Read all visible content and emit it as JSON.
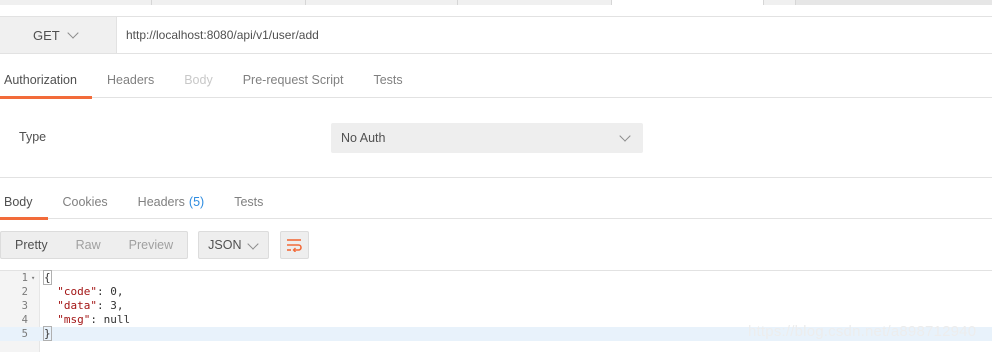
{
  "request": {
    "method": "GET",
    "url": "http://localhost:8080/api/v1/user/add"
  },
  "request_tabs": [
    {
      "label": "Authorization",
      "state": "active"
    },
    {
      "label": "Headers",
      "state": "normal"
    },
    {
      "label": "Body",
      "state": "disabled"
    },
    {
      "label": "Pre-request Script",
      "state": "normal"
    },
    {
      "label": "Tests",
      "state": "normal"
    }
  ],
  "auth": {
    "type_label": "Type",
    "type_value": "No Auth"
  },
  "response_tabs": {
    "body": "Body",
    "cookies": "Cookies",
    "headers": "Headers",
    "headers_count": "(5)",
    "tests": "Tests"
  },
  "view_modes": [
    "Pretty",
    "Raw",
    "Preview"
  ],
  "active_view_mode": "Pretty",
  "format": "JSON",
  "code_lines": [
    {
      "num": "1",
      "text": "{"
    },
    {
      "num": "2",
      "key": "\"code\"",
      "sep": ": ",
      "value": "0",
      "end": ","
    },
    {
      "num": "3",
      "key": "\"data\"",
      "sep": ": ",
      "value": "3",
      "end": ","
    },
    {
      "num": "4",
      "key": "\"msg\"",
      "sep": ": ",
      "value": "null",
      "end": ""
    },
    {
      "num": "5",
      "text": "}"
    }
  ],
  "watermark": "https://blog.csdn.net/a898712940",
  "colors": {
    "accent": "#f26b3a",
    "link": "#2e8ce0",
    "json_key": "#a31515",
    "highlight_line": "#e8f2fb"
  }
}
